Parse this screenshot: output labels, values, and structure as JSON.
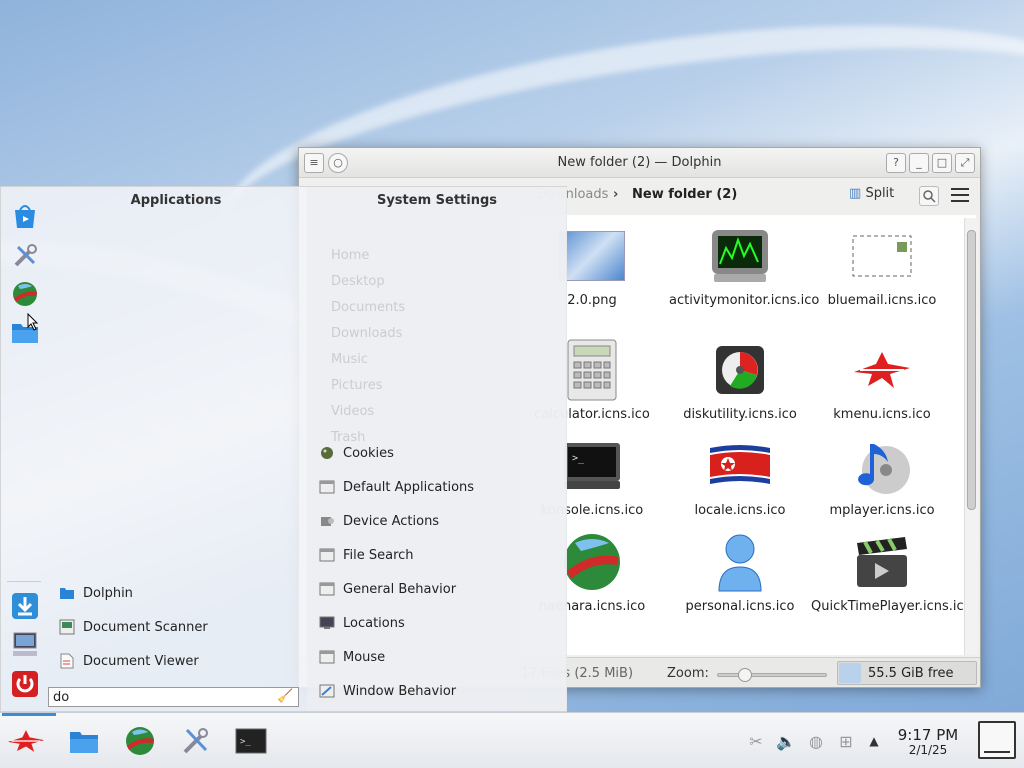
{
  "window": {
    "title": "New folder (2) — Dolphin",
    "breadcrumb_parent": "Downloads",
    "breadcrumb_current": "New folder (2)",
    "split_label": "Split"
  },
  "files": [
    {
      "name": "2.0.png",
      "icon": "wallpaper-image-icon"
    },
    {
      "name": "activitymonitor.icns.ico",
      "icon": "activity-monitor-icon"
    },
    {
      "name": "bluemail.icns.ico",
      "icon": "mail-envelope-icon"
    },
    {
      "name": "calculator.icns.ico",
      "icon": "calculator-icon"
    },
    {
      "name": "diskutility.icns.ico",
      "icon": "disk-utility-icon"
    },
    {
      "name": "kmenu.icns.ico",
      "icon": "kmenu-star-icon"
    },
    {
      "name": "konsole.icns.ico",
      "icon": "terminal-icon"
    },
    {
      "name": "locale.icns.ico",
      "icon": "flag-icon"
    },
    {
      "name": "mplayer.icns.ico",
      "icon": "music-note-icon"
    },
    {
      "name": "naenara.icns.ico",
      "icon": "globe-icon"
    },
    {
      "name": "personal.icns.ico",
      "icon": "person-icon"
    },
    {
      "name": "QuickTimePlayer.icns.ico",
      "icon": "clapperboard-icon"
    }
  ],
  "status": {
    "count": "17 Files (2.5 MiB)",
    "zoom_label": "Zoom:",
    "free_space": "55.5 GiB free"
  },
  "launcher": {
    "apps_header": "Applications",
    "settings_header": "System Settings",
    "apps": [
      {
        "label": "Dolphin",
        "icon": "folder-icon"
      },
      {
        "label": "Document Scanner",
        "icon": "scanner-icon"
      },
      {
        "label": "Document Viewer",
        "icon": "document-icon"
      }
    ],
    "settings": [
      {
        "label": "Cookies",
        "icon": "cookie-icon"
      },
      {
        "label": "Default Applications",
        "icon": "window-icon"
      },
      {
        "label": "Device Actions",
        "icon": "device-icon"
      },
      {
        "label": "File Search",
        "icon": "window-icon"
      },
      {
        "label": "General Behavior",
        "icon": "window-icon"
      },
      {
        "label": "Locations",
        "icon": "monitor-icon"
      },
      {
        "label": "Mouse",
        "icon": "window-icon"
      },
      {
        "label": "Window Behavior",
        "icon": "window-icon"
      }
    ],
    "ghost_places": [
      "Home",
      "Desktop",
      "Documents",
      "Downloads",
      "Music",
      "Pictures",
      "Videos",
      "Trash"
    ],
    "search_value": "do"
  },
  "taskbar": {
    "time": "9:17 PM",
    "date": "2/1/25"
  },
  "colors": {
    "accent": "#3c8bd8",
    "taskbar": "#eef0f3",
    "power_red": "#d42020"
  }
}
